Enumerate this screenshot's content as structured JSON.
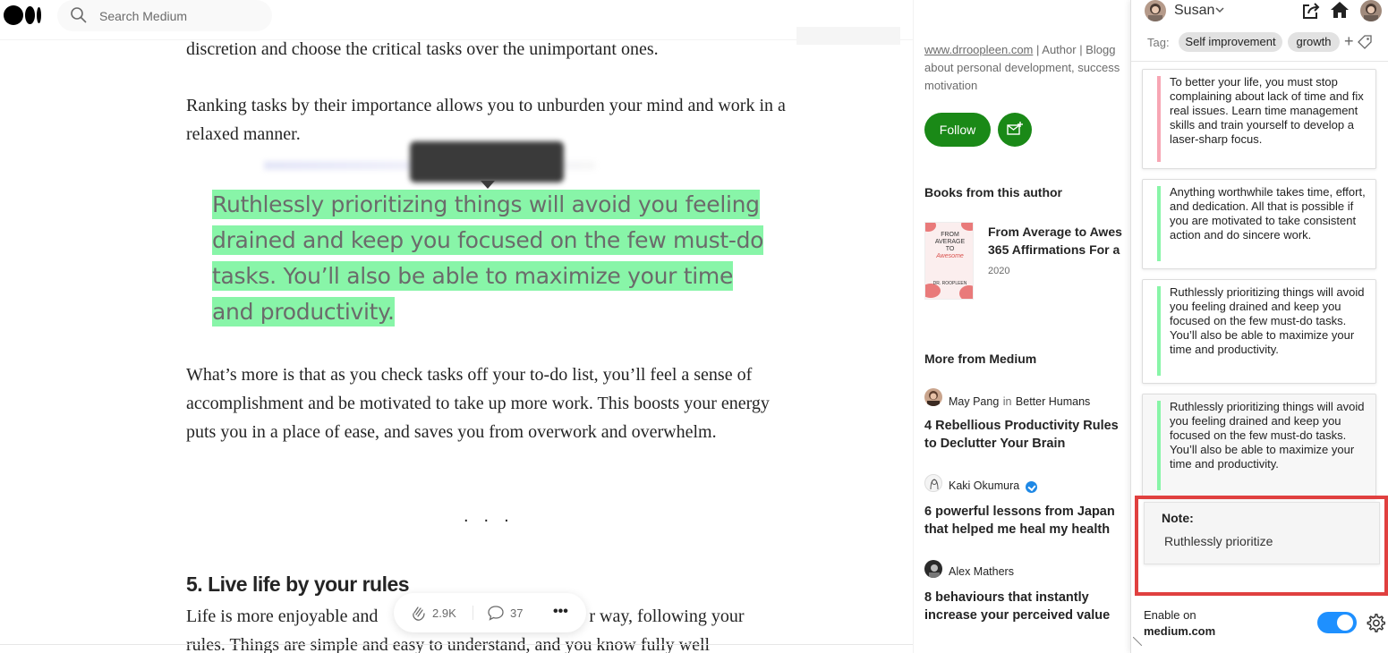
{
  "header": {
    "search_placeholder": "Search Medium"
  },
  "article": {
    "p1": "discretion and choose the critical tasks over the unimportant ones.",
    "p2": "Ranking tasks by their importance allows you to unburden your mind and work in a relaxed manner.",
    "quote": "Ruthlessly prioritizing things will avoid you feeling drained and keep you focused on the few must-do tasks. You’ll also be able to maximize your time and productivity.",
    "p3": "What’s more is that as you check tasks off your to-do list, you’ll feel a sense of accomplishment and be motivated to take up more work. This boosts your energy puts you in a place of ease, and saves you from overwork and overwhelm.",
    "separator": "...",
    "heading": "5. Live life by your rules",
    "p5_start": "Life is more enjoyable and",
    "p5_end": "r way, following your",
    "p5_line2": "rules. Things are simple and easy to understand, and you know fully well"
  },
  "actions": {
    "claps": "2.9K",
    "comments": "37",
    "more": "•••"
  },
  "sidebar": {
    "author_link": "www.drroopleen.com",
    "author_bio_1": " | Author | Blogg",
    "author_bio_2": "about personal development, success",
    "author_bio_3": "motivation",
    "follow_label": "Follow",
    "books_heading": "Books from this author",
    "book": {
      "title_line1": "From Average to Awes",
      "title_line2": "365 Affirmations For a",
      "year": "2020",
      "cover_line1": "FROM",
      "cover_line2": "AVERAGE",
      "cover_line3": "TO",
      "cover_line4": "Awesome",
      "cover_author": "DR. ROOPLEEN"
    },
    "more_heading": "More from Medium",
    "stories": [
      {
        "author": "May Pang",
        "in": "in",
        "publication": "Better Humans",
        "title": "4 Rebellious Productivity Rules to Declutter Your Brain"
      },
      {
        "author": "Kaki Okumura",
        "title": "6 powerful lessons from Japan that helped me heal my health"
      },
      {
        "author": "Alex Mathers",
        "title": "8 behaviours that instantly increase your perceived value"
      }
    ]
  },
  "panel": {
    "username": "Susan",
    "tag_label": "Tag:",
    "tags": [
      "Self improvement",
      "growth"
    ],
    "tag_add": "+",
    "notes": [
      {
        "text": "To better your life, you must stop complaining about lack of time and fix real issues. Learn time management skills and train yourself to develop a laser-sharp focus.",
        "color": "#f7a6b4"
      },
      {
        "text": "Anything worthwhile takes time, effort, and dedication. All that is possible if you are motivated to take consistent action and do sincere work.",
        "color": "#88f5a8"
      },
      {
        "text": "Ruthlessly prioritizing things will avoid you feeling drained and keep you focused on the few must-do tasks. You’ll also be able to maximize your time and productivity.",
        "color": "#88f5a8"
      },
      {
        "text": "Ruthlessly prioritizing things will avoid you feeling drained and keep you focused on the few must-do tasks. You’ll also be able to maximize your time and productivity.",
        "color": "#88f5a8"
      }
    ],
    "note_label": "Note:",
    "note_value": "Ruthlessly prioritize",
    "enable_label": "Enable on",
    "enable_site": "medium.com",
    "toggle_on": true
  },
  "colors": {
    "highlight": "#88f5a8",
    "follow_green": "#1a8917",
    "toggle_blue": "#1e90ff",
    "outline_red": "#e0403f"
  }
}
